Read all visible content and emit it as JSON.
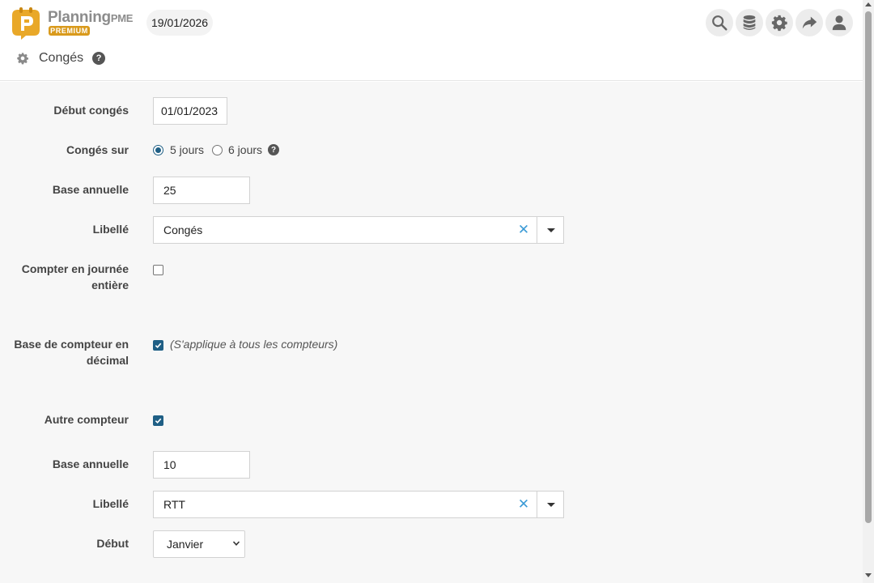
{
  "header": {
    "logo": {
      "name": "Planning",
      "suffix": "PME",
      "badge": "PREMIUM"
    },
    "date": "19/01/2026",
    "tools": [
      {
        "icon": "search-icon"
      },
      {
        "icon": "database-icon"
      },
      {
        "icon": "gear-icon"
      },
      {
        "icon": "share-icon"
      },
      {
        "icon": "user-icon"
      }
    ]
  },
  "breadcrumb": {
    "icon": "gear-icon",
    "title": "Congés",
    "help": "?"
  },
  "form": {
    "debut_conges": {
      "label": "Début congés",
      "value": "01/01/2023"
    },
    "conges_sur": {
      "label": "Congés sur",
      "options": [
        {
          "label": "5 jours",
          "selected": true
        },
        {
          "label": "6 jours",
          "selected": false
        }
      ],
      "help": "?"
    },
    "base_annuelle": {
      "label": "Base annuelle",
      "value": "25"
    },
    "libelle": {
      "label": "Libellé",
      "value": "Congés",
      "clear": "✕"
    },
    "journee_entiere": {
      "label": "Compter en journée entière",
      "checked": false
    },
    "decimal": {
      "label": "Base de compteur en décimal",
      "checked": true,
      "hint": "(S'applique à tous les compteurs)"
    },
    "autre_compteur": {
      "label": "Autre compteur",
      "checked": true
    },
    "base_annuelle_2": {
      "label": "Base annuelle",
      "value": "10"
    },
    "libelle_2": {
      "label": "Libellé",
      "value": "RTT",
      "clear": "✕"
    },
    "debut": {
      "label": "Début",
      "value": "Janvier"
    }
  },
  "colors": {
    "accent": "#1f5f85",
    "clear": "#3c9bd6",
    "brand": "#d99a1c"
  }
}
